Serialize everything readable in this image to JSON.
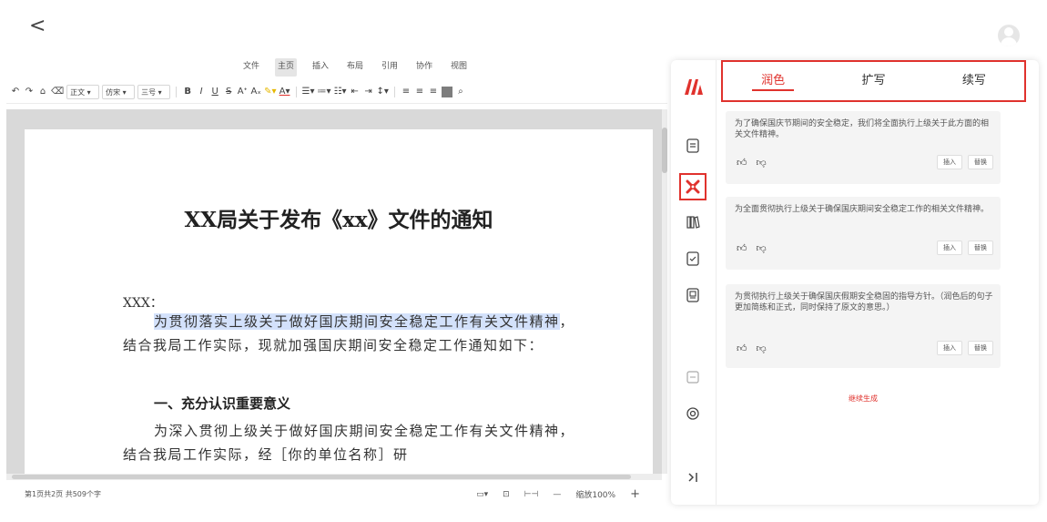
{
  "app": {
    "back_label": "<"
  },
  "menu": [
    {
      "label": "文件",
      "active": false
    },
    {
      "label": "主页",
      "active": true
    },
    {
      "label": "插入",
      "active": false
    },
    {
      "label": "布局",
      "active": false
    },
    {
      "label": "引用",
      "active": false
    },
    {
      "label": "协作",
      "active": false
    },
    {
      "label": "视图",
      "active": false
    }
  ],
  "toolbar": {
    "style_select": "正文",
    "font_select": "仿宋",
    "size_select": "三号",
    "bold": "B",
    "italic": "I",
    "underline": "U",
    "strike": "S"
  },
  "document": {
    "title": "XX局关于发布《xx》文件的通知",
    "greeting": "XXX：",
    "para1_highlight": "为贯彻落实上级关于做好国庆期间安全稳定工作有关文件精神",
    "para1_rest": "，结合我局工作实际，现就加强国庆期间安全稳定工作通知如下：",
    "heading1": "一、充分认识重要意义",
    "para2": "为深入贯彻上级关于做好国庆期间安全稳定工作有关文件精神，结合我局工作实际，经［你的单位名称］研"
  },
  "status": {
    "page_info": "第1页共2页  共509个字",
    "zoom_label": "缩放100%",
    "zoom_out": "—",
    "zoom_in": "+"
  },
  "panel": {
    "tabs": [
      {
        "label": "润色",
        "active": true
      },
      {
        "label": "扩写",
        "active": false
      },
      {
        "label": "续写",
        "active": false
      }
    ],
    "cards": [
      {
        "text": "为了确保国庆节期间的安全稳定，我们将全面执行上级关于此方面的相关文件精神。",
        "insert": "插入",
        "replace": "替换"
      },
      {
        "text": "为全面贯彻执行上级关于确保国庆期间安全稳定工作的相关文件精神。",
        "insert": "插入",
        "replace": "替换"
      },
      {
        "text": "为贯彻执行上级关于确保国庆假期安全稳固的指导方针。（润色后的句子更加简练和正式，同时保持了原文的意思。）",
        "insert": "插入",
        "replace": "替换"
      }
    ],
    "continue_label": "继续生成"
  },
  "colors": {
    "accent": "#e0322d",
    "highlight": "#d3e1fb",
    "canvas": "#d9d9d9"
  }
}
